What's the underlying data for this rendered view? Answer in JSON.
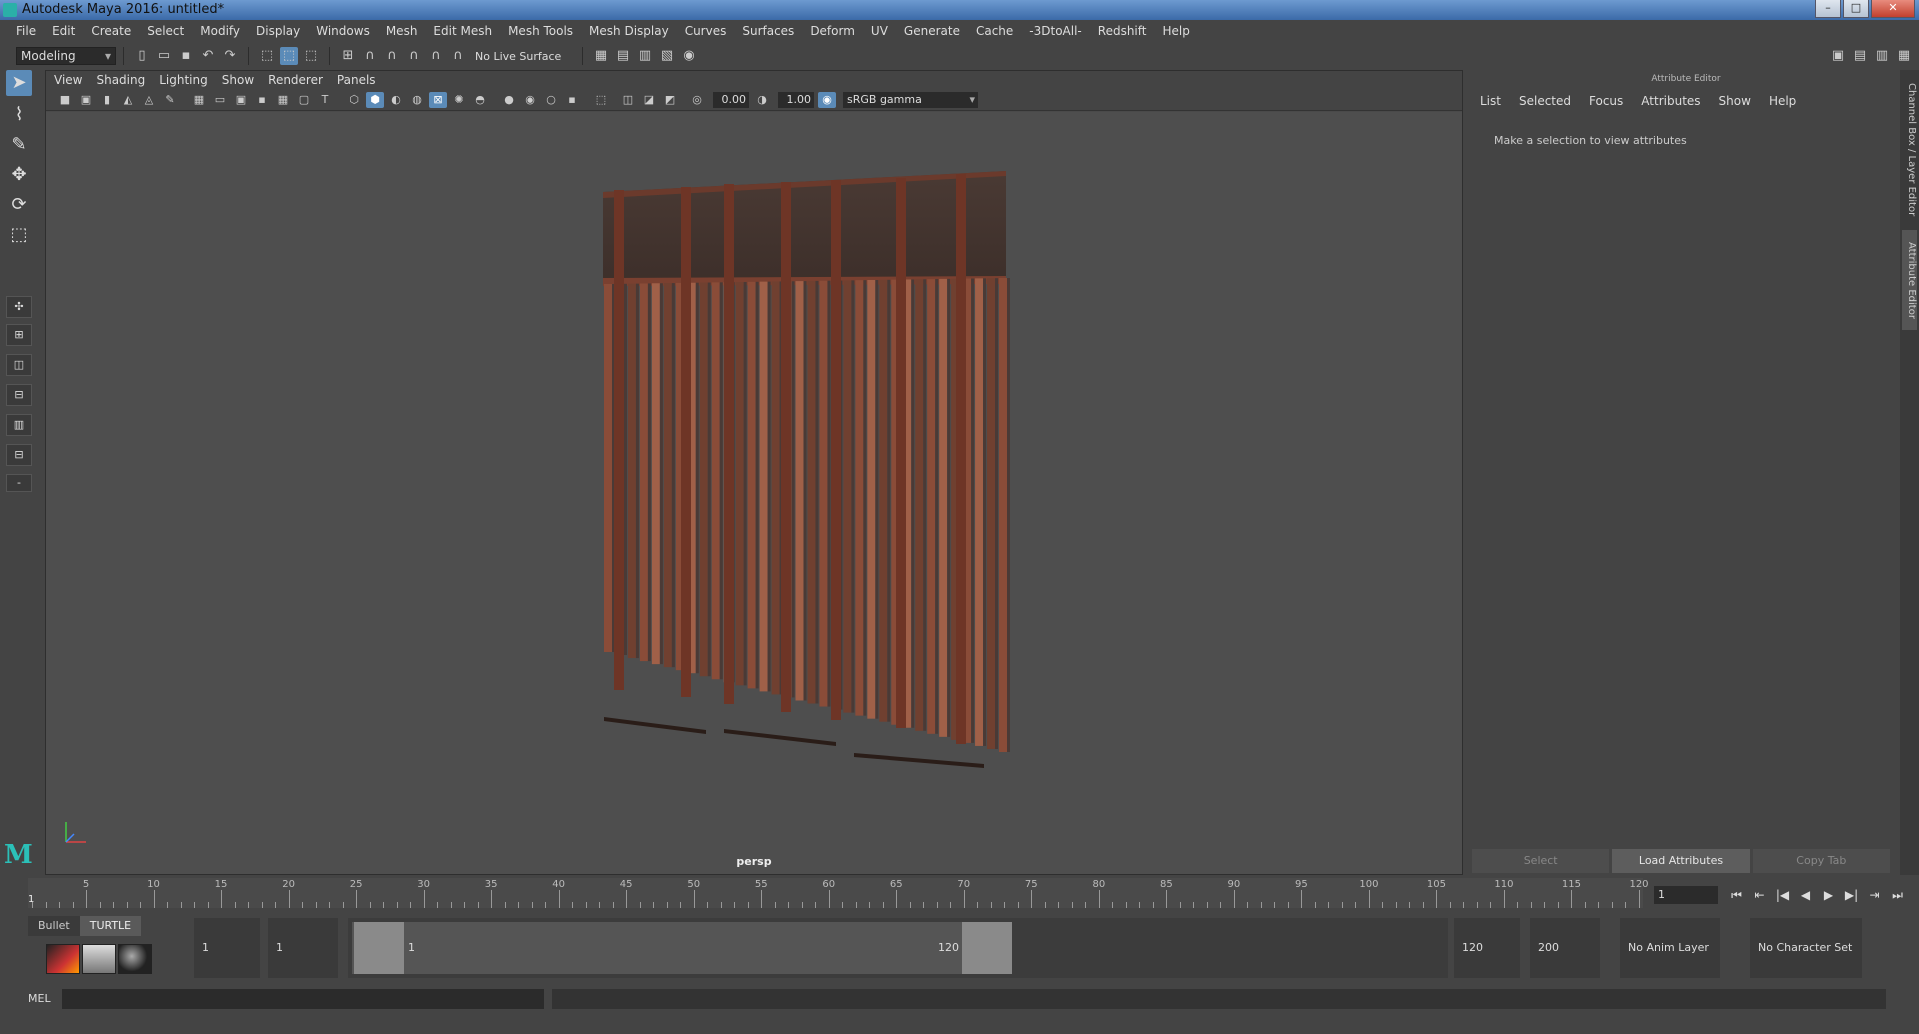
{
  "window": {
    "title": "Autodesk Maya 2016: untitled*"
  },
  "menubar": {
    "items": [
      "File",
      "Edit",
      "Create",
      "Select",
      "Modify",
      "Display",
      "Windows",
      "Mesh",
      "Edit Mesh",
      "Mesh Tools",
      "Mesh Display",
      "Curves",
      "Surfaces",
      "Deform",
      "UV",
      "Generate",
      "Cache",
      "-3DtoAll-",
      "Redshift",
      "Help"
    ]
  },
  "statusline": {
    "mode": "Modeling",
    "live_surface": "No Live Surface"
  },
  "panel": {
    "menu": [
      "View",
      "Shading",
      "Lighting",
      "Show",
      "Renderer",
      "Panels"
    ],
    "exposure": "0.00",
    "gamma": "1.00",
    "color_space": "sRGB gamma",
    "camera": "persp"
  },
  "attribute_editor": {
    "title": "Attribute Editor",
    "menu": [
      "List",
      "Selected",
      "Focus",
      "Attributes",
      "Show",
      "Help"
    ],
    "hint": "Make a selection to view attributes",
    "buttons": {
      "select": "Select",
      "load": "Load Attributes",
      "copy": "Copy Tab"
    }
  },
  "side_tabs": {
    "channel_box": "Channel Box / Layer Editor",
    "attribute_editor": "Attribute Editor"
  },
  "timeline": {
    "ticks": [
      "5",
      "10",
      "15",
      "20",
      "25",
      "30",
      "35",
      "40",
      "45",
      "50",
      "55",
      "60",
      "65",
      "70",
      "75",
      "80",
      "85",
      "90",
      "95",
      "100",
      "105",
      "110",
      "115",
      "120"
    ],
    "current_frame_marker": "1",
    "current_frame": "1"
  },
  "range": {
    "shelf_tabs": [
      "Bullet",
      "TURTLE"
    ],
    "start_time": "1",
    "playback_start": "1",
    "range_start_label": "1",
    "range_end_label": "120",
    "playback_end": "120",
    "end_time": "200",
    "anim_layer": "No Anim Layer",
    "character_set": "No Character Set"
  },
  "cmdline": {
    "label": "MEL"
  }
}
